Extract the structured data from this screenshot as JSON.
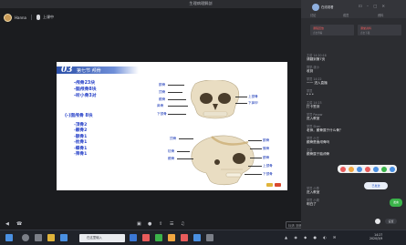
{
  "window": {
    "title": "生理病理解剖"
  },
  "presenter": {
    "name": "Hanna",
    "mic_label": "上课中"
  },
  "slide": {
    "section_num": "03",
    "section_title": "第七节 颅骨",
    "skull_summary": [
      "-颅骨23块",
      "-脑颅骨8块",
      "-听小骨3对"
    ],
    "face_header": "(-)面颅骨 8块",
    "face_bones": [
      "-顶骨2",
      "-颞骨2",
      "-额骨1",
      "-枕骨1",
      "-蝶骨1",
      "-筛骨1"
    ],
    "front_labels": [
      "额骨",
      "顶骨",
      "颞骨",
      "鼻骨",
      "上颌骨",
      "泪骨",
      "下颌骨",
      "颧骨",
      "下鼻甲"
    ],
    "side_labels": [
      "顶骨",
      "额骨",
      "颞骨",
      "枕骨",
      "蝶骨",
      "颧骨",
      "上颌骨",
      "下颌骨"
    ]
  },
  "controls": {
    "quality": "标清 流畅"
  },
  "panel": {
    "user": "在线观看",
    "tabs": [
      "讨论",
      "成员",
      "资料"
    ],
    "cards": [
      {
        "title": "课程回放",
        "sub": "点击查看"
      },
      {
        "title": "课堂资料",
        "sub": "点击下载"
      }
    ],
    "messages": [
      {
        "who": "主讲 14:20:16",
        "text": "请翻到第7页"
      },
      {
        "who": "同学-张小",
        "text": "收到"
      },
      {
        "who": "学员 14:22",
        "text": "一一 进入直播"
      },
      {
        "who": "学员",
        "text": "* * *"
      },
      {
        "who": "主讲 14:23",
        "text": "打卡签到"
      },
      {
        "who": "学员 Pasaw",
        "text": "进入教室"
      },
      {
        "who": "学员 Shan",
        "text": "老师，颞骨属于什么骨？"
      },
      {
        "who": "学员 小王",
        "text": "颞骨是面颅骨吗"
      },
      {
        "who": "主讲",
        "text": "颞骨属于脑颅骨"
      },
      {
        "who": "学员 小李",
        "text": "进入教室"
      },
      {
        "who": "学员 小周",
        "text": "明白了"
      }
    ],
    "bubble": "已发送",
    "green_button": "发言",
    "bottom_button": "设置"
  },
  "taskbar": {
    "search_placeholder": "在这里输入",
    "time": "14:27",
    "date": "2020/3/9"
  },
  "colors": {
    "accent": "#2741c8",
    "chat_red": "#e85c5c",
    "green": "#3bb34a"
  }
}
